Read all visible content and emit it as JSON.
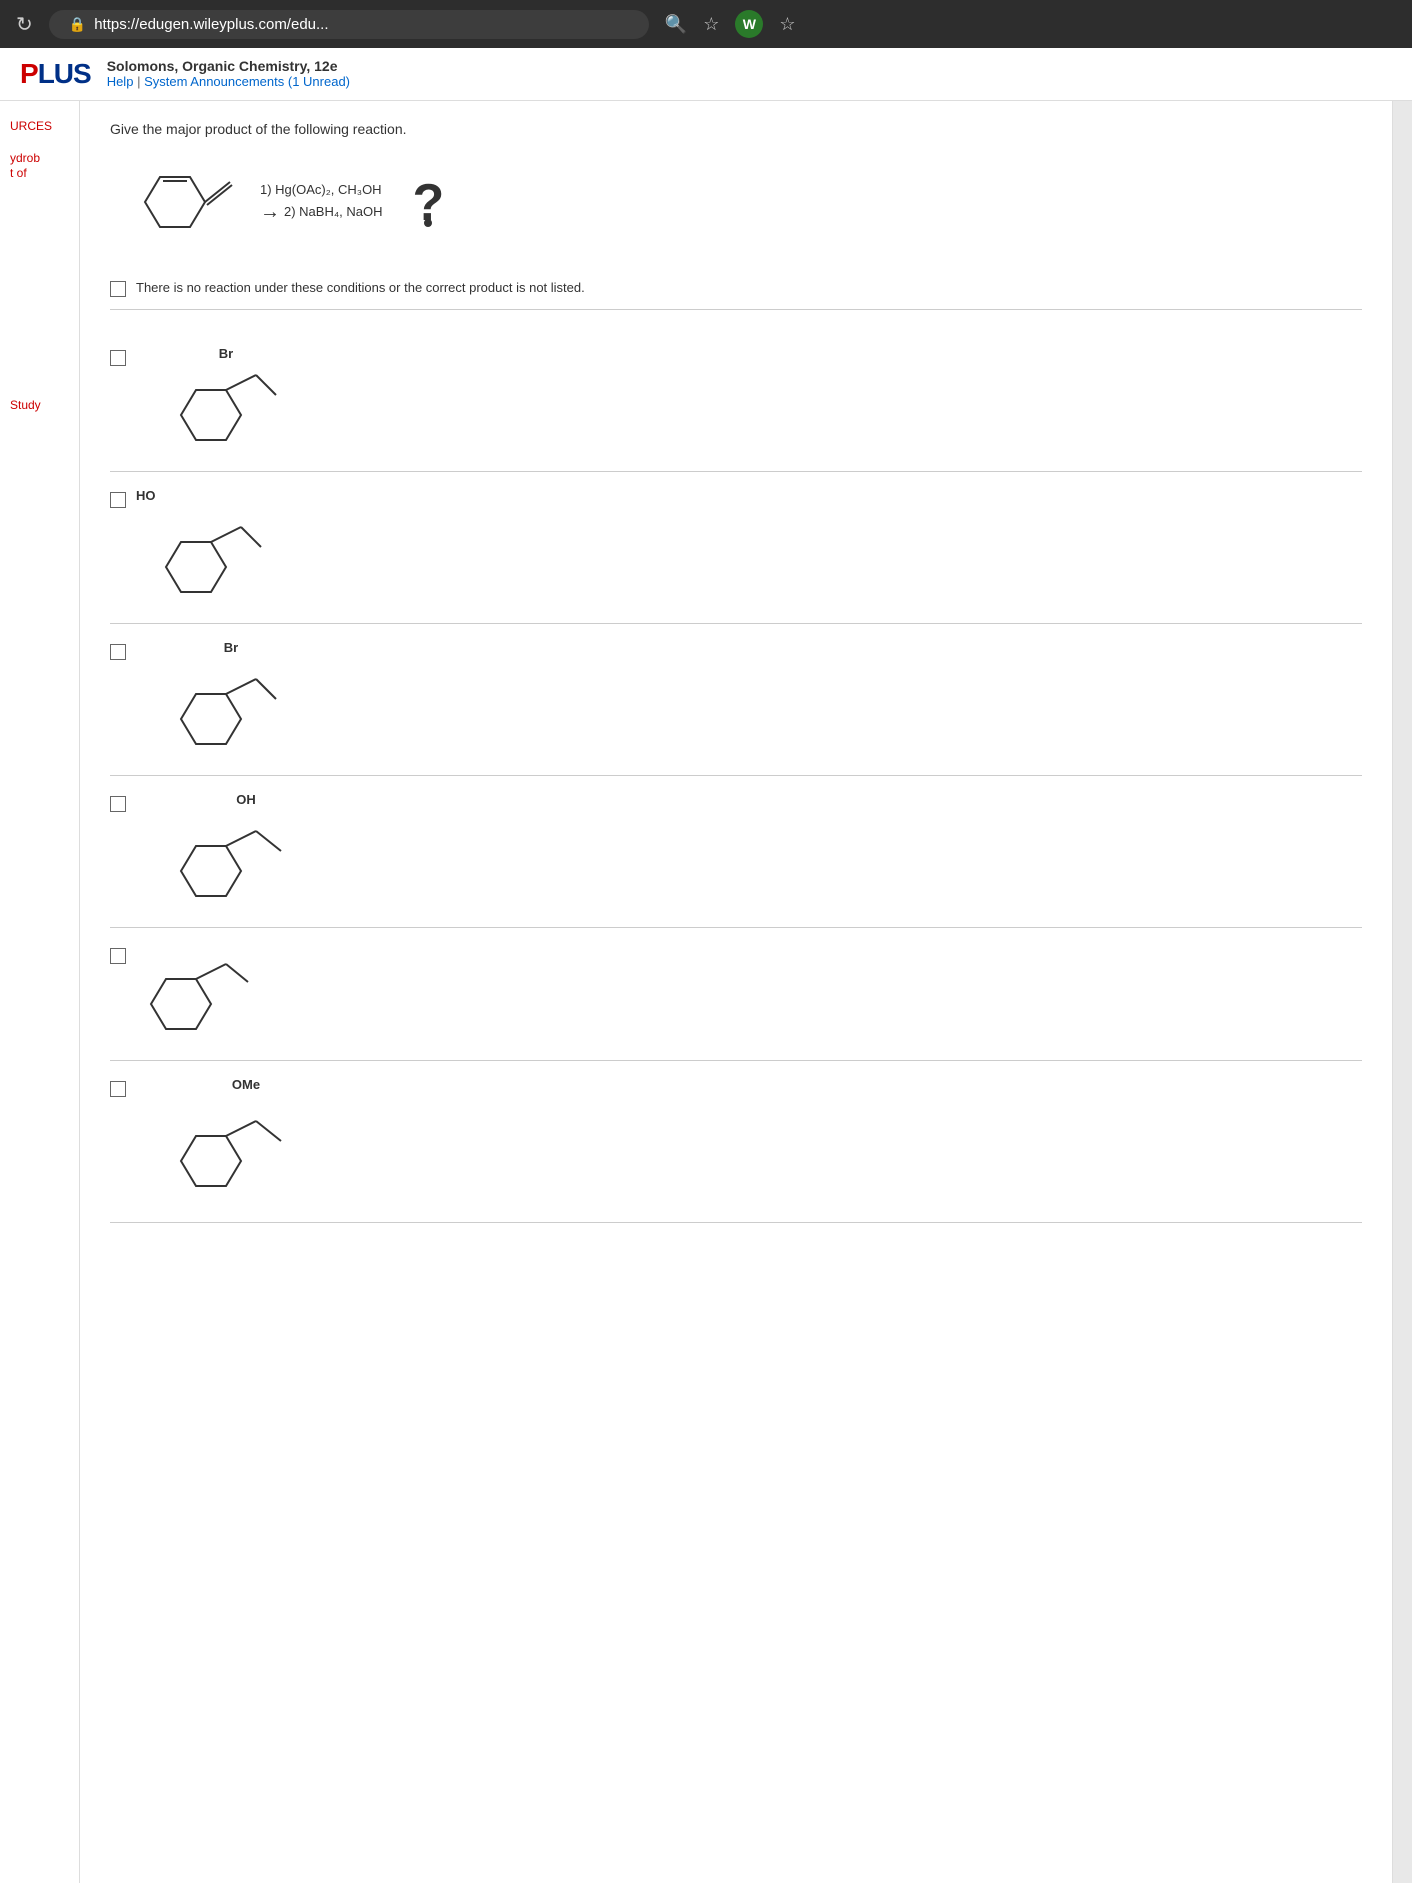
{
  "browser": {
    "url": "https://edugen.wileyplus.com/edu...",
    "refresh_icon": "↻",
    "lock_icon": "🔒",
    "search_icon": "🔍",
    "star_icon": "☆",
    "w_icon": "W",
    "menu_icon": "☆"
  },
  "header": {
    "logo_text": "PLUS",
    "logo_prefix": "P",
    "book_title": "Solomons, Organic Chemistry, 12e",
    "help_link": "Help",
    "announcements_link": "System Announcements (1 Unread)",
    "separator": "|"
  },
  "sidebar": {
    "resources_label": "URCES",
    "hydrob_label": "ydrob",
    "t_of_label": "t of",
    "study_label": "Study"
  },
  "question": {
    "text": "Give the major product of the following reaction.",
    "reaction": {
      "step1": "1) Hg(OAc)₂, CH₃OH",
      "step2": "2) NaBH₄, NaOH",
      "arrow": "→"
    },
    "no_reaction_text": "There is no reaction under these conditions or the correct product is not listed.",
    "options": [
      {
        "id": "option-br-top",
        "substituent": "Br",
        "substituent_position": "top"
      },
      {
        "id": "option-ho",
        "substituent": "HO",
        "substituent_position": "left"
      },
      {
        "id": "option-br-side",
        "substituent": "Br",
        "substituent_position": "side"
      },
      {
        "id": "option-oh",
        "substituent": "OH",
        "substituent_position": "side"
      },
      {
        "id": "option-none",
        "substituent": "",
        "substituent_position": "none"
      },
      {
        "id": "option-ome",
        "substituent": "OMe",
        "substituent_position": "bottom"
      }
    ]
  }
}
